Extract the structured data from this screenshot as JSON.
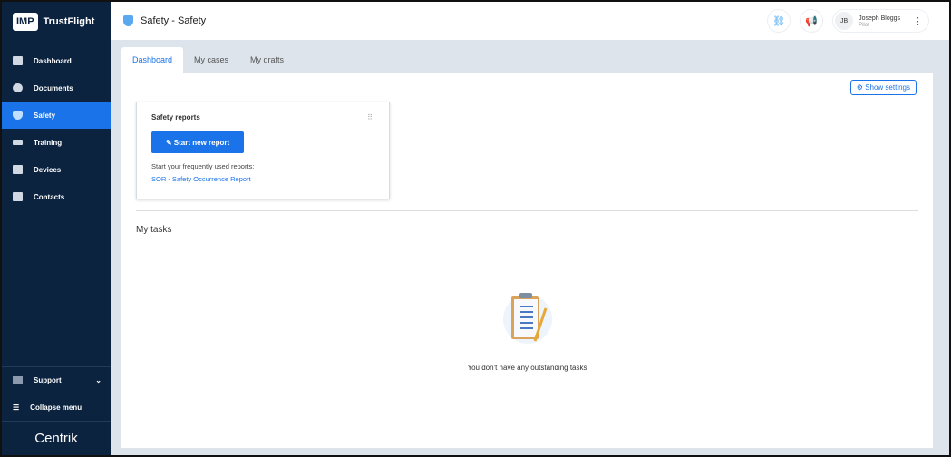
{
  "sidebar": {
    "logo_mark": "IMP",
    "brand": "TrustFlight",
    "items": [
      {
        "label": "Dashboard",
        "icon": "dashboard-icon"
      },
      {
        "label": "Documents",
        "icon": "paperclip-icon"
      },
      {
        "label": "Safety",
        "icon": "shield-icon",
        "active": true
      },
      {
        "label": "Training",
        "icon": "graduation-cap-icon"
      },
      {
        "label": "Devices",
        "icon": "devices-icon"
      },
      {
        "label": "Contacts",
        "icon": "contacts-icon"
      }
    ],
    "support": "Support",
    "collapse": "Collapse menu",
    "footer_logo": "Centrik"
  },
  "header": {
    "title": "Safety - Safety",
    "user": {
      "initials": "JB",
      "name": "Joseph Bloggs",
      "role": "Pilot"
    }
  },
  "tabs": [
    "Dashboard",
    "My cases",
    "My drafts"
  ],
  "main": {
    "show_settings": "Show settings",
    "card": {
      "title": "Safety reports",
      "start_button": "Start new report",
      "hint": "Start your frequently used reports:",
      "link": "SOR - Safety Occurrence Report"
    },
    "tasks_title": "My tasks",
    "empty_text": "You don't have any outstanding tasks"
  }
}
